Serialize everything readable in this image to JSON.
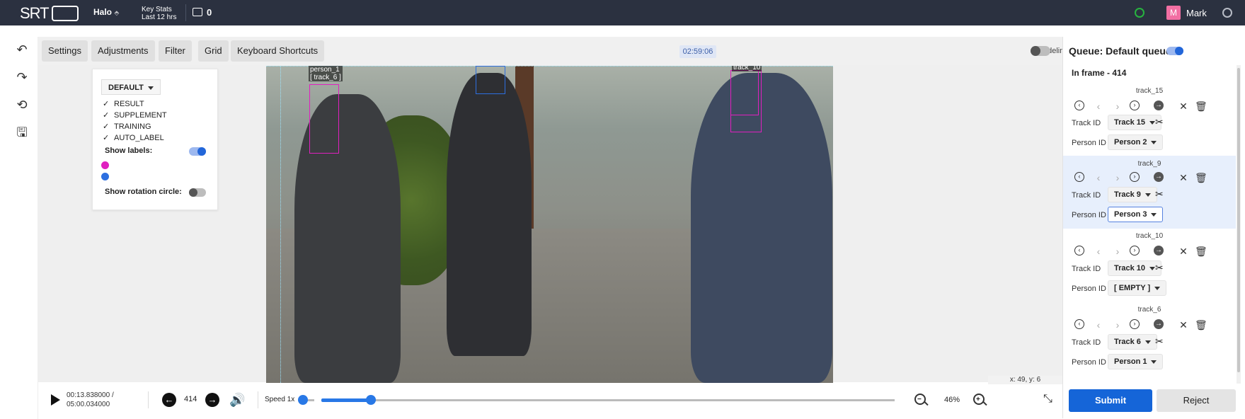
{
  "topbar": {
    "logo": "SRT",
    "project": "Halo",
    "keystats_title": "Key Stats",
    "keystats_sub": "Last 12 hrs",
    "briefcase_count": "0",
    "user": "Mark",
    "avatar_initial": "M"
  },
  "toolbar": {
    "settings": "Settings",
    "adjustments": "Adjustments",
    "filter": "Filter",
    "grid": "Grid",
    "shortcuts": "Keyboard Shortcuts",
    "timer": "02:59:06",
    "guideline": "Guideline",
    "guideline_on": false
  },
  "label_panel": {
    "dropdown": "DEFAULT",
    "checks": [
      "RESULT",
      "SUPPLEMENT",
      "TRAINING",
      "AUTO_LABEL"
    ],
    "show_labels": "Show labels:",
    "show_labels_on": true,
    "show_rotation": "Show rotation circle:",
    "show_rotation_on": false,
    "dot_colors": [
      "#e020c0",
      "#2d6fe0"
    ]
  },
  "video": {
    "box_label_1": "person_1\n[ track_6 ]",
    "box_label_2": "track_10"
  },
  "coords": "x: 49, y: 6",
  "player": {
    "time_current": "00:13.838000 /",
    "time_total": "05:00.034000",
    "frame": "414",
    "speed": "Speed 1x",
    "speed_fraction": 0.09,
    "progress_fraction": 0.087,
    "zoom": "46%"
  },
  "queue": {
    "title": "Queue: Default queue",
    "queue_toggle_on": true,
    "in_frame": "In frame - 414",
    "track_label": "Track ID",
    "person_label": "Person ID",
    "tracks": [
      {
        "name": "track_15",
        "track_id": "Track 15",
        "person_id": "Person 2"
      },
      {
        "name": "track_9",
        "track_id": "Track 9",
        "person_id": "Person 3"
      },
      {
        "name": "track_10",
        "track_id": "Track 10",
        "person_id": "[ EMPTY ]"
      },
      {
        "name": "track_6",
        "track_id": "Track 6",
        "person_id": "Person 1"
      }
    ],
    "submit": "Submit",
    "reject": "Reject"
  },
  "colors": {
    "topbar": "#2b3140",
    "accent": "#1565d8",
    "box_magenta": "#e020c0",
    "box_blue": "#2d6fe0"
  }
}
